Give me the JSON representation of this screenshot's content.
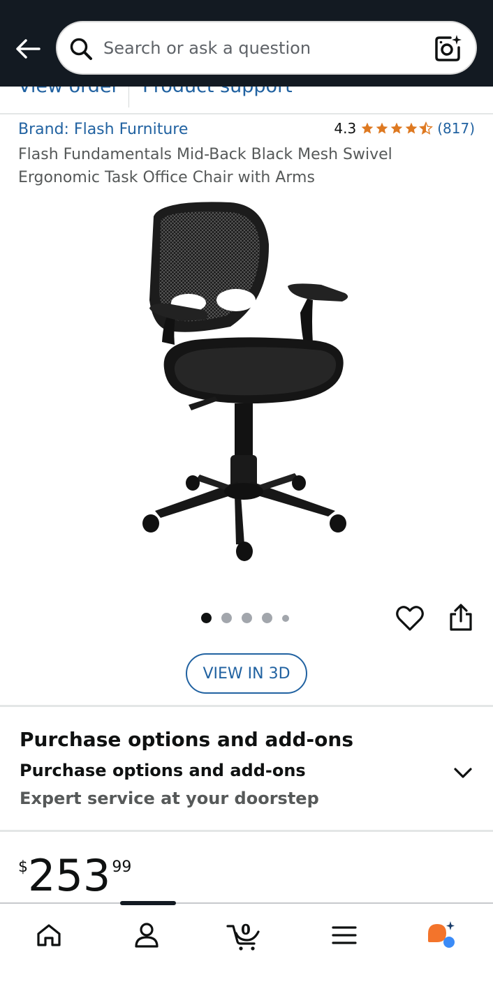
{
  "header": {
    "search_placeholder": "Search or ask a question"
  },
  "links": {
    "view_order": "View order",
    "product_support": "Product support"
  },
  "product": {
    "brand": "Brand: Flash Furniture",
    "rating_value": "4.3",
    "rating_count": "(817)",
    "rating_stars": 4.3,
    "title": "Flash Fundamentals Mid-Back Black Mesh Swivel Ergonomic Task Office Chair with Arms",
    "image_count": 5,
    "active_image": 1
  },
  "view_3d_label": "VIEW IN 3D",
  "purchase_options": {
    "heading": "Purchase options and add-ons",
    "subheading": "Purchase options and add-ons",
    "caption": "Expert service at your doorstep"
  },
  "price": {
    "symbol": "$",
    "whole": "253",
    "fraction": "99"
  },
  "bottom_nav": {
    "items": [
      "home-icon",
      "account-icon",
      "cart-icon",
      "menu-icon",
      "rufus-icon"
    ],
    "cart_count": "0",
    "active": "account-icon"
  },
  "colors": {
    "header_bg": "#131a22",
    "link": "#2162a1",
    "star": "#de7921",
    "assistant_orange": "#f3742b",
    "assistant_blue": "#3b8bf7"
  }
}
